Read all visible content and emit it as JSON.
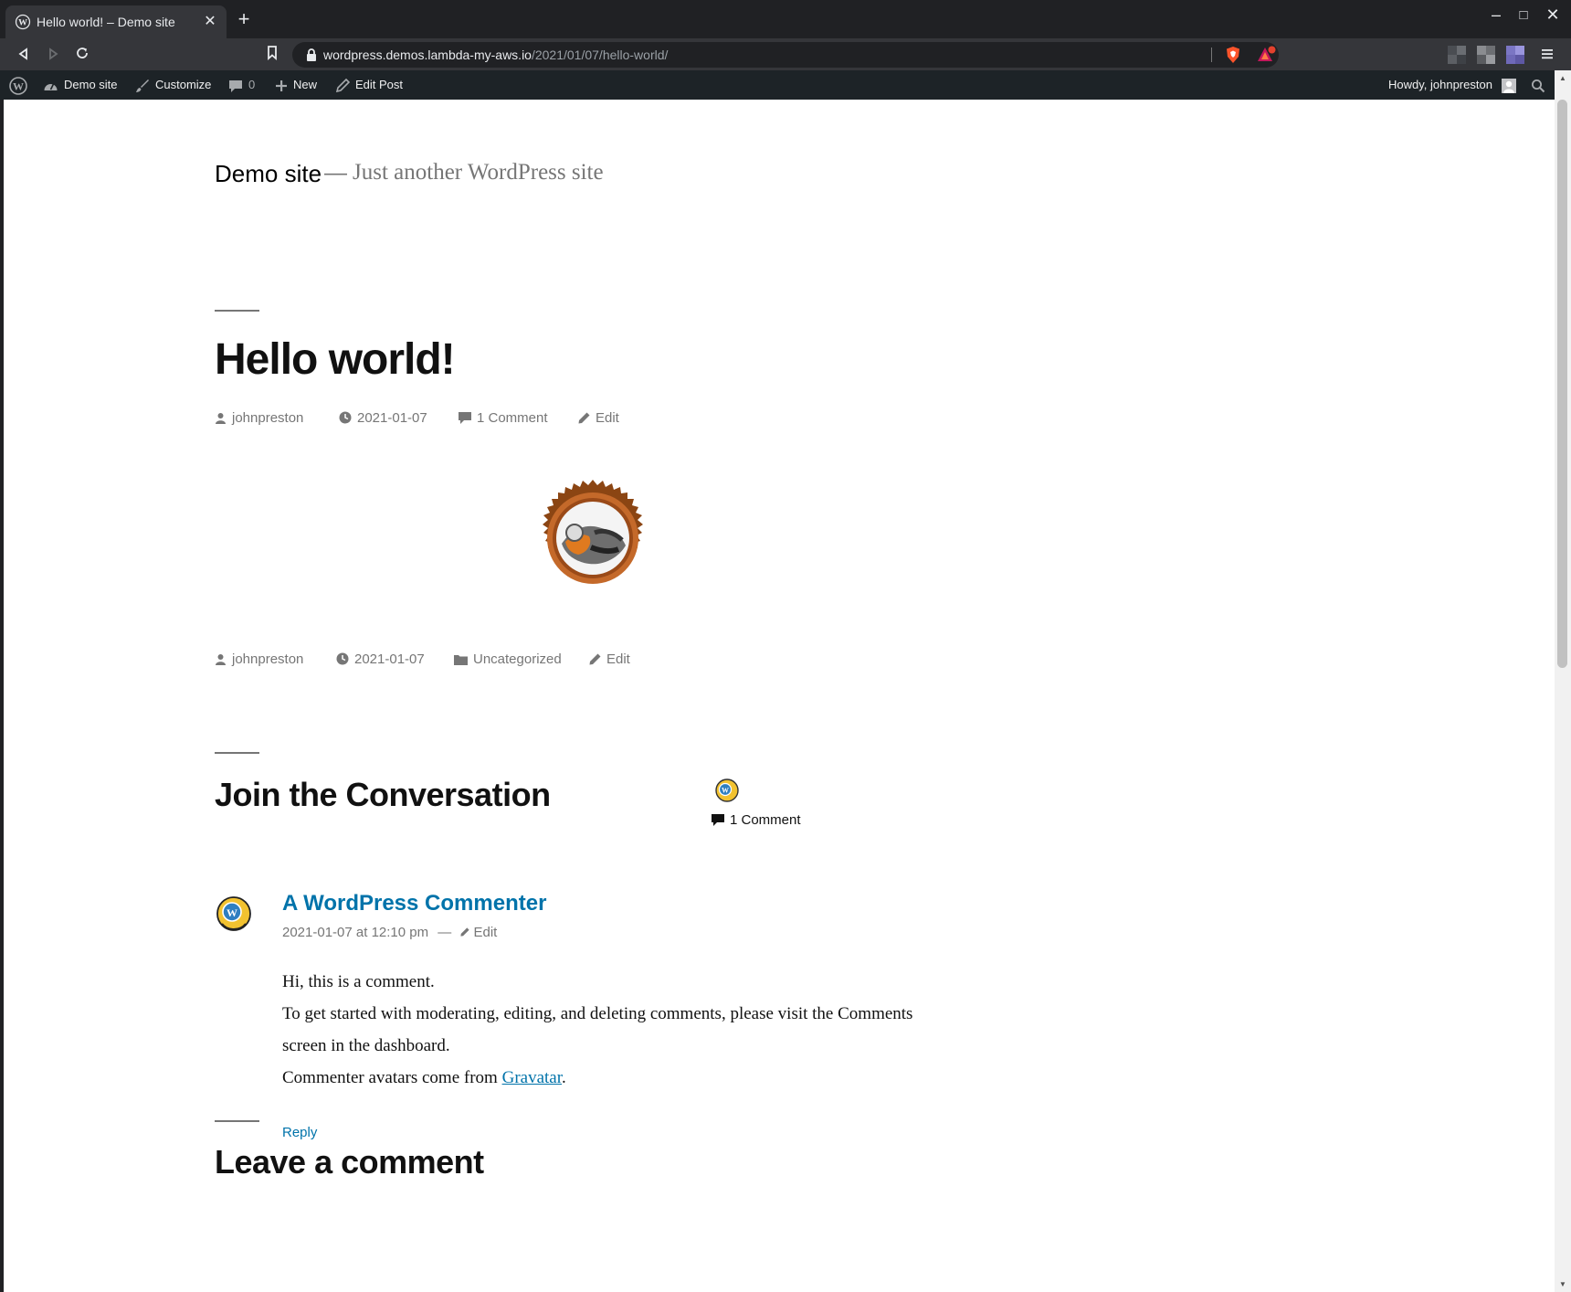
{
  "browser": {
    "tab_title": "Hello world! – Demo site",
    "tab_close": "✕",
    "new_tab": "+",
    "url_host": "wordpress.demos.lambda-my-aws.io",
    "url_path": "/2021/01/07/hello-world/",
    "window_controls": {
      "minimize": "–",
      "maximize": "□",
      "close": "✕"
    },
    "rewards_badge_count": ""
  },
  "admin_bar": {
    "site_name": "Demo site",
    "customize": "Customize",
    "comments_count": "0",
    "new": "New",
    "edit_post": "Edit Post",
    "howdy": "Howdy, johnpreston"
  },
  "site": {
    "title": "Demo site",
    "separator": "—",
    "description": "Just another WordPress site"
  },
  "post": {
    "title": "Hello world!",
    "author": "johnpreston",
    "date": "2021-01-07",
    "comments_link": "1 Comment",
    "edit": "Edit",
    "footer_author": "johnpreston",
    "footer_date": "2021-01-07",
    "category": "Uncategorized",
    "footer_edit": "Edit"
  },
  "comments_section": {
    "heading": "Join the Conversation",
    "count": "1 Comment",
    "comment": {
      "author": "A WordPress Commenter",
      "date": "2021-01-07 at 12:10 pm",
      "date_separator": "—",
      "edit": "Edit",
      "line1": "Hi, this is a comment.",
      "line2": "To get started with moderating, editing, and deleting comments, please visit the Comments screen in the dashboard.",
      "line3_prefix": "Commenter avatars come from ",
      "line3_link": "Gravatar",
      "line3_suffix": ".",
      "reply": "Reply"
    }
  },
  "leave_comment": {
    "heading": "Leave a comment"
  },
  "colors": {
    "link": "#0073aa",
    "admin_bar_bg": "#1d2327",
    "meta_gray": "#767676"
  }
}
